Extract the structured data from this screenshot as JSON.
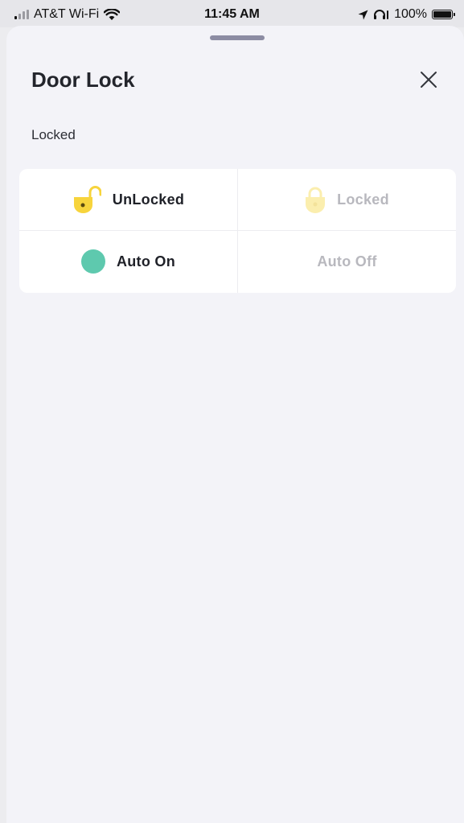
{
  "status_bar": {
    "carrier": "AT&T Wi-Fi",
    "time": "11:45 AM",
    "battery": "100%"
  },
  "sheet": {
    "title": "Door Lock",
    "status": "Locked"
  },
  "controls": {
    "unlock": {
      "label": "UnLocked",
      "state": "active"
    },
    "lock": {
      "label": "Locked",
      "state": "inactive"
    },
    "auto_on": {
      "label": "Auto On",
      "state": "active"
    },
    "auto_off": {
      "label": "Auto Off",
      "state": "inactive"
    }
  },
  "icons": {
    "unlock": "unlocked-padlock-icon",
    "lock": "locked-padlock-icon",
    "auto_on": "auto-on-dot-icon",
    "close": "close-icon"
  },
  "colors": {
    "lock_yellow": "#f7d43c",
    "lock_yellow_faded": "#fbeeae",
    "auto_teal": "#5ec9ae",
    "title_text": "#23252c",
    "inactive_text": "#b8b8be"
  }
}
